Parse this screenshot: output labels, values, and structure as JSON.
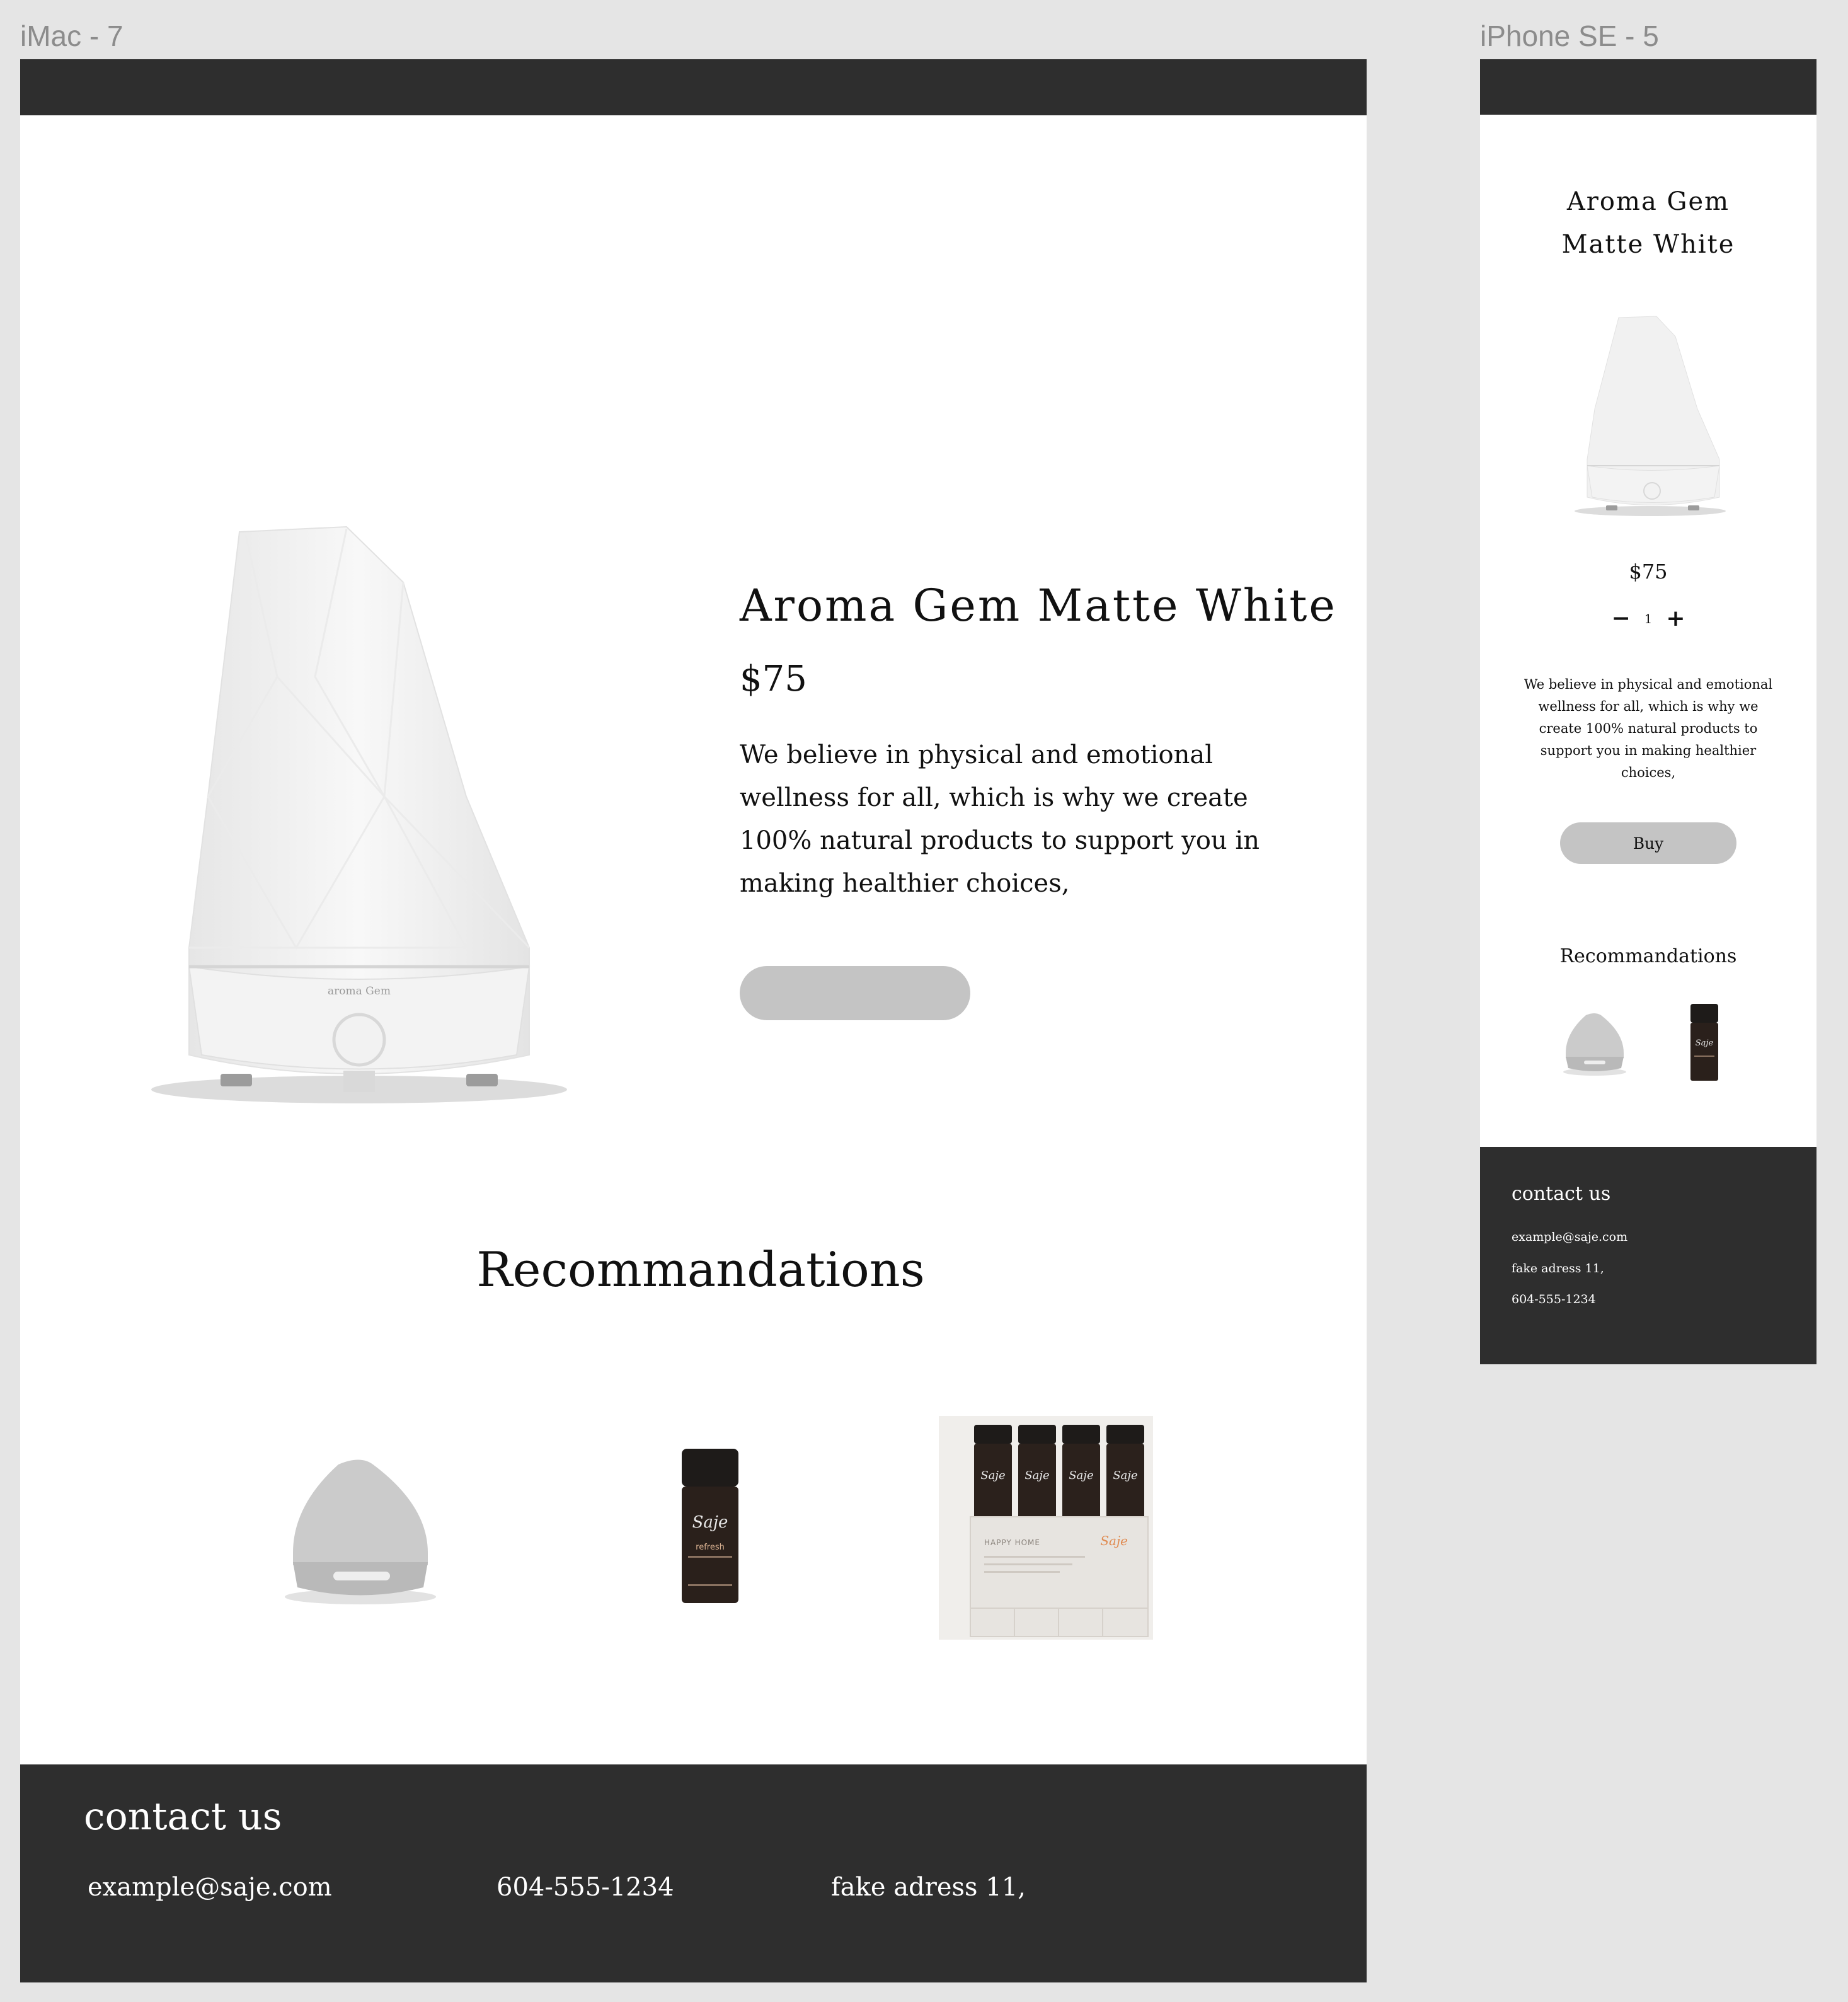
{
  "frames": {
    "desktop_label": "iMac - 7",
    "mobile_label": "iPhone SE - 5"
  },
  "product": {
    "name": "Aroma Gem Matte White",
    "name_line1": "Aroma Gem",
    "name_line2": "Matte White",
    "price": "$75",
    "description": "We believe in physical and emotional wellness for all, which is why we create 100% natural products to support you in making healthier choices,",
    "quantity": "1",
    "decrease_symbol": "−",
    "increase_symbol": "+",
    "buy_label": "Buy"
  },
  "recommendations": {
    "title": "Recommandations",
    "items": [
      {
        "icon": "dome-diffuser-image"
      },
      {
        "icon": "oil-bottle-image",
        "brand": "Saje",
        "label": "refresh"
      },
      {
        "icon": "gift-set-image",
        "brand": "Saje",
        "label": "HAPPY HOME"
      }
    ]
  },
  "footer": {
    "title": "contact us",
    "email": "example@saje.com",
    "phone": "604-555-1234",
    "address": "fake adress 11,"
  },
  "colors": {
    "bar": "#2e2e2e",
    "button": "#c4c4c4",
    "canvas": "#e5e5e5"
  }
}
